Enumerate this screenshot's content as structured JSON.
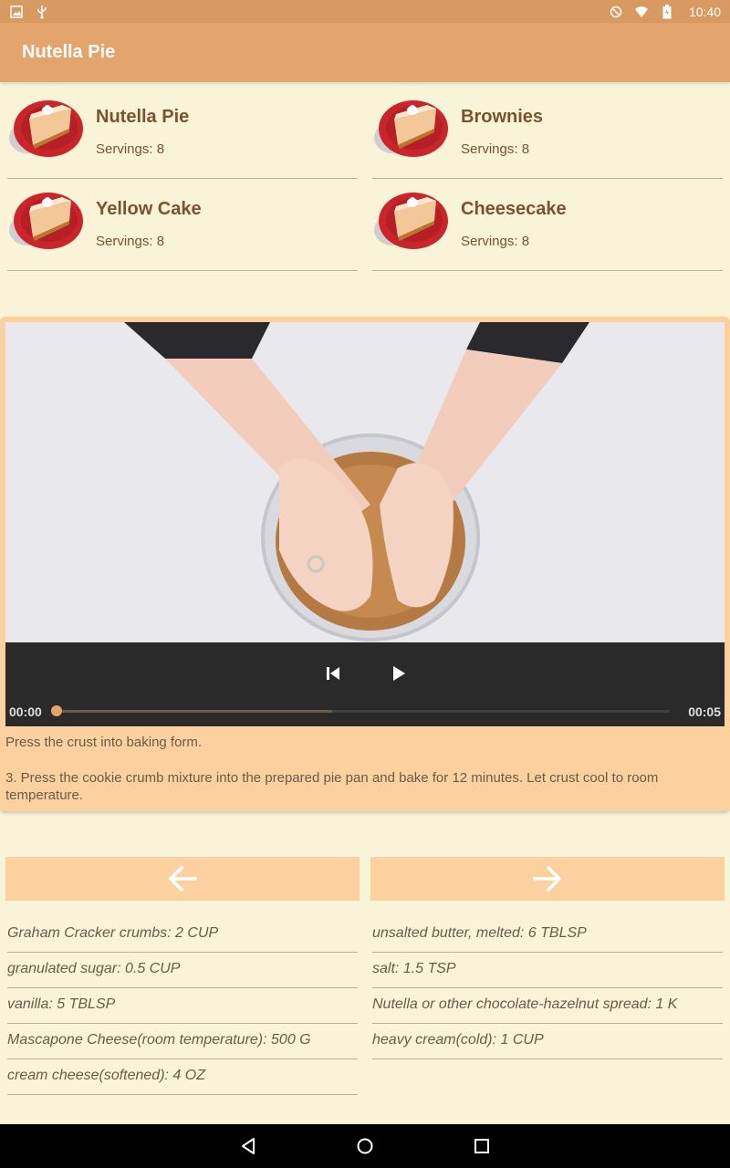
{
  "status_bar": {
    "time": "10:40",
    "left_icons": [
      "image-icon",
      "usb-icon"
    ],
    "right_icons": [
      "do-not-disturb-icon",
      "wifi-icon",
      "battery-icon"
    ]
  },
  "app_bar": {
    "title": "Nutella Pie"
  },
  "recipes": [
    {
      "name": "Nutella Pie",
      "servings": "Servings: 8"
    },
    {
      "name": "Brownies",
      "servings": "Servings: 8"
    },
    {
      "name": "Yellow Cake",
      "servings": "Servings: 8"
    },
    {
      "name": "Cheesecake",
      "servings": "Servings: 8"
    }
  ],
  "video": {
    "current_time": "00:00",
    "duration": "00:05",
    "progress": 0.0,
    "buffered": 0.45
  },
  "step": {
    "short_description": "Press the crust into baking form.",
    "description": "3. Press the cookie crumb mixture into the prepared pie pan and bake for 12 minutes. Let crust cool to room temperature."
  },
  "ingredients_left": [
    "Graham Cracker crumbs: 2 CUP",
    "granulated sugar: 0.5 CUP",
    "vanilla: 5 TBLSP",
    "Mascapone Cheese(room temperature): 500 G",
    "cream cheese(softened): 4 OZ"
  ],
  "ingredients_right": [
    "unsalted butter, melted: 6 TBLSP",
    "salt: 1.5 TSP",
    "Nutella or other chocolate-hazelnut spread: 1 K",
    "heavy cream(cold): 1 CUP"
  ],
  "colors": {
    "app_bar": "#e3a46d",
    "background": "#f9f4d8",
    "panel": "#fdd09f",
    "recipe_text": "#7b5230"
  }
}
